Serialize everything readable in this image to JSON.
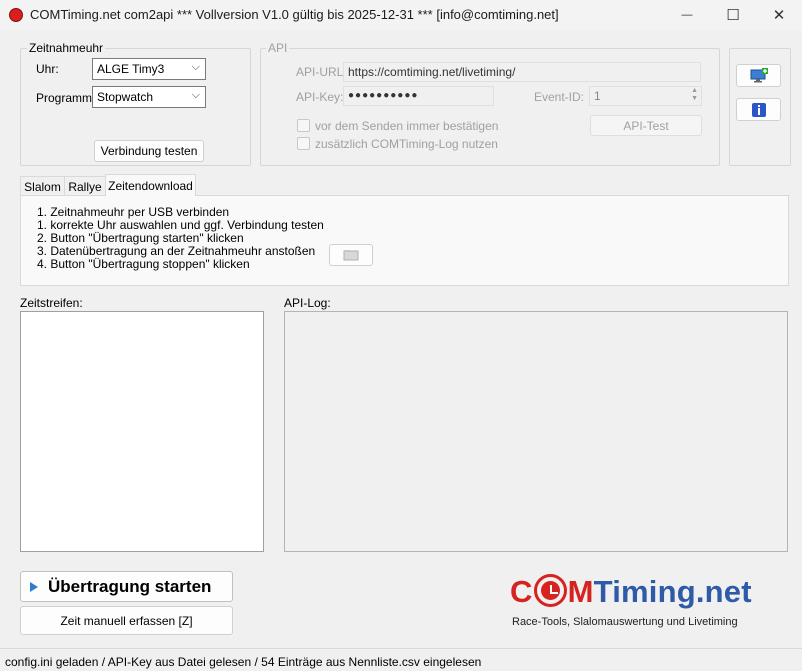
{
  "window": {
    "title": "COMTiming.net com2api *** Vollversion V1.0 gültig bis 2025-12-31 *** [info@comtiming.net]",
    "minimize_glyph": "—",
    "maximize_glyph": "☐",
    "close_glyph": "✕"
  },
  "zeitnahmeuhr": {
    "group_label": "Zeitnahmeuhr",
    "uhr_label": "Uhr:",
    "uhr_value": "ALGE Timy3",
    "programm_label": "Programm:",
    "programm_value": "Stopwatch",
    "test_button": "Verbindung testen"
  },
  "api": {
    "group_label": "API",
    "url_label": "API-URL:",
    "url_value": "https://comtiming.net/livetiming/",
    "key_label": "API-Key:",
    "key_value": "●●●●●●●●●●",
    "event_label": "Event-ID:",
    "event_value": "1",
    "confirm_label": "vor dem Senden immer bestätigen",
    "log_label": "zusätzlich COMTiming-Log nutzen",
    "test_button": "API-Test"
  },
  "side_buttons": {
    "monitor_icon": "monitor-add-icon",
    "info_icon": "info-icon"
  },
  "tabs": [
    {
      "label": "Slalom"
    },
    {
      "label": "Rallye"
    },
    {
      "label": "Zeitendownload"
    }
  ],
  "instructions": [
    "1. Zeitnahmeuhr per USB verbinden",
    "1. korrekte Uhr auswahlen und ggf. Verbindung testen",
    "2. Button \"Übertragung starten\" klicken",
    "3. Datenübertragung an der Zeitnahmeuhr anstoßen",
    "4. Button \"Übertragung stoppen\" klicken"
  ],
  "panels": {
    "zeitstreifen_label": "Zeitstreifen:",
    "apilog_label": "API-Log:"
  },
  "actions": {
    "start_button": "Übertragung starten",
    "manual_button": "Zeit manuell erfassen [Z]"
  },
  "logo": {
    "part1": "C",
    "part2": "M",
    "part3": "Timing.net",
    "subtitle": "Race-Tools, Slalomauswertung und Livetiming"
  },
  "status": "config.ini geladen / API-Key aus Datei gelesen / 54 Einträge aus Nennliste.csv eingelesen",
  "colors": {
    "logo_red": "#d6231f",
    "logo_blue": "#2e5aa8",
    "start_arrow": "#2f7bd3"
  }
}
